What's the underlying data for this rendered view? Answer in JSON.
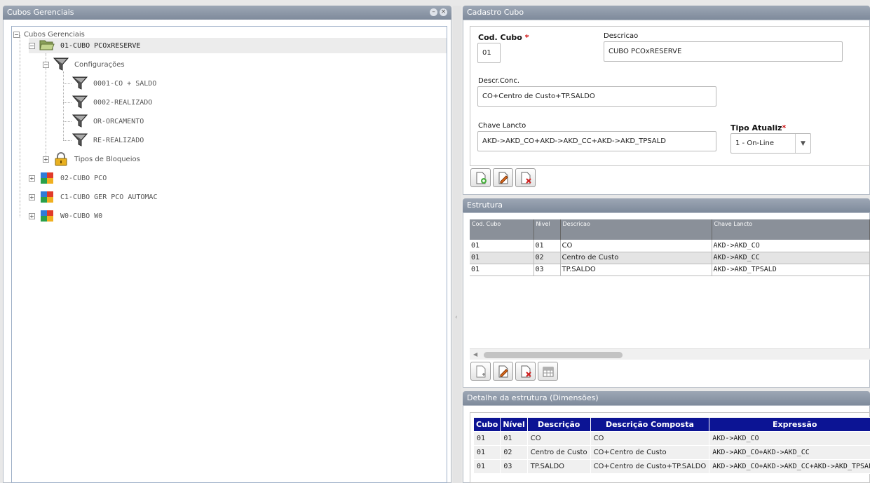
{
  "left_panel": {
    "title": "Cubos Gerenciais",
    "tree": [
      {
        "label": "Cubos Gerenciais",
        "expander": "−",
        "icon": "none"
      },
      {
        "label": "01-CUBO PCOxRESERVE",
        "expander": "−",
        "icon": "folder-open-icon"
      },
      {
        "label": "Configurações",
        "expander": "−",
        "icon": "funnel-icon"
      },
      {
        "label": "0001-CO + SALDO",
        "icon": "funnel-icon"
      },
      {
        "label": "0002-REALIZADO",
        "icon": "funnel-icon"
      },
      {
        "label": "OR-ORCAMENTO",
        "icon": "funnel-icon"
      },
      {
        "label": "RE-REALIZADO",
        "icon": "funnel-icon"
      },
      {
        "label": "Tipos de Bloqueios",
        "expander": "+",
        "icon": "lock-icon"
      },
      {
        "label": "02-CUBO PCO",
        "expander": "+",
        "icon": "cube-icon"
      },
      {
        "label": "C1-CUBO GER PCO AUTOMAC",
        "expander": "+",
        "icon": "cube-icon"
      },
      {
        "label": "W0-CUBO W0",
        "expander": "+",
        "icon": "cube-icon"
      }
    ]
  },
  "cadastro": {
    "title": "Cadastro Cubo",
    "cod_cubo_label": "Cod. Cubo",
    "cod_cubo_value": "01",
    "descricao_label": "Descricao",
    "descricao_value": "CUBO PCOxRESERVE",
    "descr_conc_label": "Descr.Conc.",
    "descr_conc_value": "CO+Centro de Custo+TP.SALDO",
    "chave_label": "Chave Lancto",
    "chave_value": "AKD->AKD_CO+AKD->AKD_CC+AKD->AKD_TPSALD",
    "tipo_label": "Tipo Atualiz",
    "tipo_value": "1 - On-Line",
    "required_mark": "*",
    "dropdown_arrow": "▼"
  },
  "estrutura": {
    "title": "Estrutura",
    "columns": [
      "Cod. Cubo",
      "Nivel",
      "Descricao",
      "Chave Lancto"
    ],
    "rows": [
      [
        "01",
        "01",
        "CO",
        "AKD->AKD_CO"
      ],
      [
        "01",
        "02",
        "Centro de Custo",
        "AKD->AKD_CC"
      ],
      [
        "01",
        "03",
        "TP.SALDO",
        "AKD->AKD_TPSALD"
      ]
    ],
    "scroll_left": "◀"
  },
  "detalhe": {
    "title": "Detalhe da estrutura (Dimensões)",
    "columns": [
      "Cubo",
      "Nível",
      "Descrição",
      "Descrição Composta",
      "Expressão"
    ],
    "rows": [
      [
        "01",
        "01",
        "CO",
        "CO",
        "AKD->AKD_CO"
      ],
      [
        "01",
        "02",
        "Centro de Custo",
        "CO+Centro de Custo",
        "AKD->AKD_CO+AKD->AKD_CC"
      ],
      [
        "01",
        "03",
        "TP.SALDO",
        "CO+Centro de Custo+TP.SALDO",
        "AKD->AKD_CO+AKD->AKD_CC+AKD->AKD_TPSALD"
      ]
    ]
  },
  "colors": {
    "header_bar": "#8a95a5",
    "grid_header_blue": "#0c1494",
    "required_red": "#d01010"
  }
}
